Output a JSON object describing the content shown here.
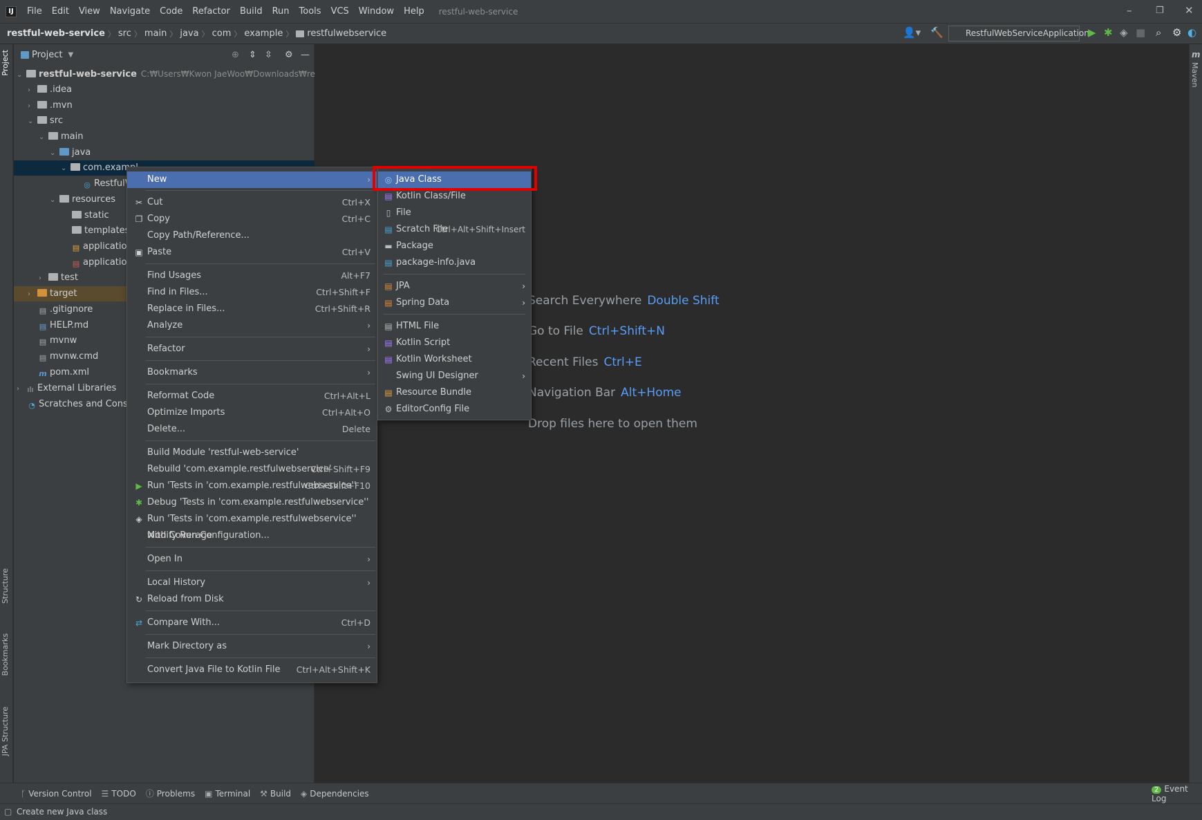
{
  "menubar": {
    "items": [
      "File",
      "Edit",
      "View",
      "Navigate",
      "Code",
      "Refactor",
      "Build",
      "Run",
      "Tools",
      "VCS",
      "Window",
      "Help"
    ],
    "window_title": "restful-web-service"
  },
  "breadcrumb": [
    "restful-web-service",
    "src",
    "main",
    "java",
    "com",
    "example",
    "restfulwebservice"
  ],
  "toolbar": {
    "run_config": "RestfulWebServiceApplication"
  },
  "side_tabs": {
    "left": [
      "Project",
      "Structure",
      "Bookmarks",
      "JPA Structure"
    ],
    "right": [
      "Maven"
    ]
  },
  "project": {
    "header": "Project",
    "root_name": "restful-web-service",
    "root_path": "C:₩Users₩Kwon JaeWoo₩Downloads₩restful-web-service",
    "nodes": [
      ".idea",
      ".mvn",
      "src",
      "main",
      "java",
      "com.exampl",
      "RestfulW",
      "resources",
      "static",
      "templates",
      "application.p",
      "application.y",
      "test",
      "target",
      ".gitignore",
      "HELP.md",
      "mvnw",
      "mvnw.cmd",
      "pom.xml",
      "External Libraries",
      "Scratches and Consoles"
    ]
  },
  "editor_hints": [
    {
      "label": "Search Everywhere",
      "key": "Double Shift"
    },
    {
      "label": "Go to File",
      "key": "Ctrl+Shift+N"
    },
    {
      "label": "Recent Files",
      "key": "Ctrl+E"
    },
    {
      "label": "Navigation Bar",
      "key": "Alt+Home"
    },
    {
      "label": "Drop files here to open them",
      "key": ""
    }
  ],
  "context_menu": [
    {
      "label": "New",
      "shortcut": "",
      "submenu": true
    },
    {
      "label": "Cut",
      "shortcut": "Ctrl+X"
    },
    {
      "label": "Copy",
      "shortcut": "Ctrl+C"
    },
    {
      "label": "Copy Path/Reference...",
      "shortcut": ""
    },
    {
      "label": "Paste",
      "shortcut": "Ctrl+V"
    },
    {
      "label": "Find Usages",
      "shortcut": "Alt+F7"
    },
    {
      "label": "Find in Files...",
      "shortcut": "Ctrl+Shift+F"
    },
    {
      "label": "Replace in Files...",
      "shortcut": "Ctrl+Shift+R"
    },
    {
      "label": "Analyze",
      "shortcut": "",
      "submenu": true
    },
    {
      "label": "Refactor",
      "shortcut": "",
      "submenu": true
    },
    {
      "label": "Bookmarks",
      "shortcut": "",
      "submenu": true
    },
    {
      "label": "Reformat Code",
      "shortcut": "Ctrl+Alt+L"
    },
    {
      "label": "Optimize Imports",
      "shortcut": "Ctrl+Alt+O"
    },
    {
      "label": "Delete...",
      "shortcut": "Delete"
    },
    {
      "label": "Build Module 'restful-web-service'",
      "shortcut": ""
    },
    {
      "label": "Rebuild 'com.example.restfulwebservice'",
      "shortcut": "Ctrl+Shift+F9"
    },
    {
      "label": "Run 'Tests in 'com.example.restfulwebservice''",
      "shortcut": "Ctrl+Shift+F10"
    },
    {
      "label": "Debug 'Tests in 'com.example.restfulwebservice''",
      "shortcut": ""
    },
    {
      "label": "Run 'Tests in 'com.example.restfulwebservice'' with Coverage",
      "shortcut": ""
    },
    {
      "label": "Modify Run Configuration...",
      "shortcut": ""
    },
    {
      "label": "Open In",
      "shortcut": "",
      "submenu": true
    },
    {
      "label": "Local History",
      "shortcut": "",
      "submenu": true
    },
    {
      "label": "Reload from Disk",
      "shortcut": ""
    },
    {
      "label": "Compare With...",
      "shortcut": "Ctrl+D"
    },
    {
      "label": "Mark Directory as",
      "shortcut": "",
      "submenu": true
    },
    {
      "label": "Convert Java File to Kotlin File",
      "shortcut": "Ctrl+Alt+Shift+K"
    }
  ],
  "submenu_new": [
    {
      "label": "Java Class",
      "shortcut": ""
    },
    {
      "label": "Kotlin Class/File",
      "shortcut": ""
    },
    {
      "label": "File",
      "shortcut": ""
    },
    {
      "label": "Scratch File",
      "shortcut": "Ctrl+Alt+Shift+Insert"
    },
    {
      "label": "Package",
      "shortcut": ""
    },
    {
      "label": "package-info.java",
      "shortcut": ""
    },
    {
      "label": "JPA",
      "shortcut": "",
      "submenu": true
    },
    {
      "label": "Spring Data",
      "shortcut": "",
      "submenu": true
    },
    {
      "label": "HTML File",
      "shortcut": ""
    },
    {
      "label": "Kotlin Script",
      "shortcut": ""
    },
    {
      "label": "Kotlin Worksheet",
      "shortcut": ""
    },
    {
      "label": "Swing UI Designer",
      "shortcut": "",
      "submenu": true
    },
    {
      "label": "Resource Bundle",
      "shortcut": ""
    },
    {
      "label": "EditorConfig File",
      "shortcut": ""
    }
  ],
  "bottom_tabs": [
    "Version Control",
    "TODO",
    "Problems",
    "Terminal",
    "Build",
    "Dependencies"
  ],
  "event_log": {
    "label": "Event Log",
    "count": "2"
  },
  "status": {
    "text": "Create new Java class"
  },
  "colors": {
    "accent": "#4b6eaf",
    "highlight_box": "#e00000",
    "background": "#2b2b2b",
    "panel": "#3c3f41",
    "link": "#589df6"
  }
}
